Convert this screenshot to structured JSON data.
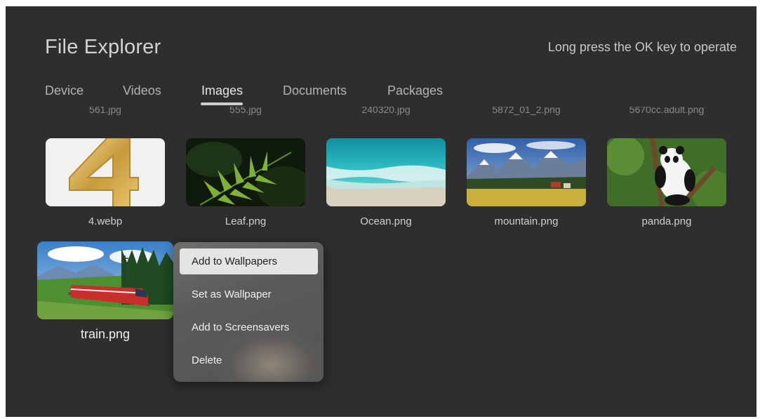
{
  "header": {
    "title": "File Explorer",
    "hint": "Long press the OK key to operate"
  },
  "tabs": [
    {
      "label": "Device"
    },
    {
      "label": "Videos"
    },
    {
      "label": "Images",
      "active": true
    },
    {
      "label": "Documents"
    },
    {
      "label": "Packages"
    }
  ],
  "previous_row_labels": [
    "561.jpg",
    "555.jpg",
    "240320.jpg",
    "5872_01_2.png",
    "5670cc.adult.png"
  ],
  "files": [
    {
      "name": "4.webp",
      "icon": "number-four-image"
    },
    {
      "name": "Leaf.png",
      "icon": "leaf-image"
    },
    {
      "name": "Ocean.png",
      "icon": "ocean-image"
    },
    {
      "name": "mountain.png",
      "icon": "mountain-image"
    },
    {
      "name": "panda.png",
      "icon": "panda-image"
    },
    {
      "name": "train.png",
      "icon": "train-image",
      "focused": true
    }
  ],
  "context_menu": {
    "items": [
      {
        "label": "Add to Wallpapers",
        "focused": true
      },
      {
        "label": "Set as Wallpaper"
      },
      {
        "label": "Add to Screensavers"
      },
      {
        "label": "Delete"
      }
    ]
  },
  "colors": {
    "background": "#2e2e2e",
    "text_primary": "#d2d2d2",
    "menu_focus": "#e4e4e4"
  }
}
